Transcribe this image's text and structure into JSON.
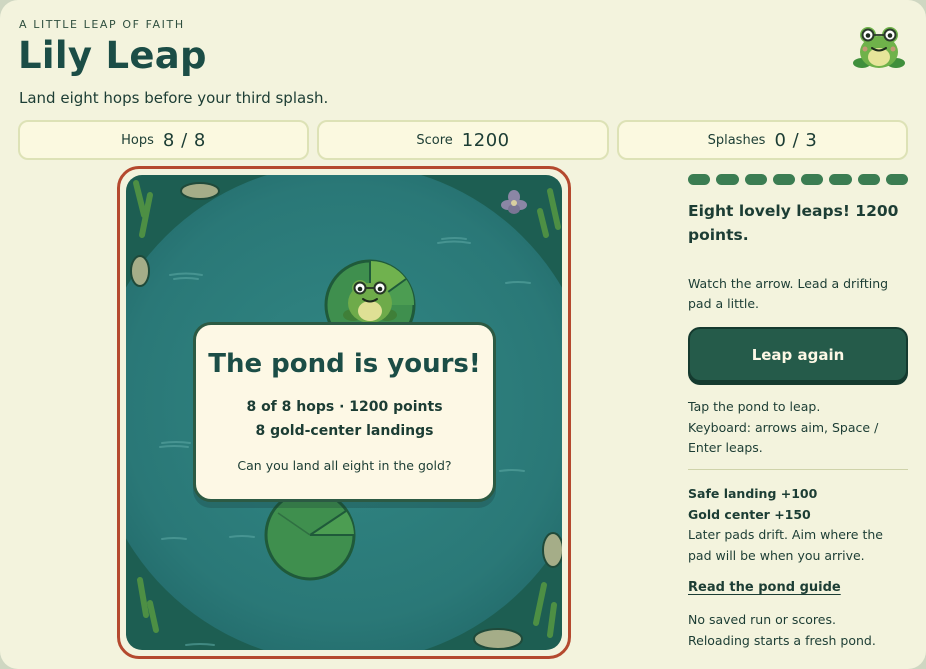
{
  "header": {
    "eyebrow": "A LITTLE LEAP OF FAITH",
    "title": "Lily Leap",
    "subtitle": "Land eight hops before your third splash."
  },
  "stats": {
    "hops_label": "Hops",
    "hops_value": "8 / 8",
    "score_label": "Score",
    "score_value": "1200",
    "splashes_label": "Splashes",
    "splashes_value": "0 / 3"
  },
  "progress": {
    "completed": 8,
    "total": 8
  },
  "modal": {
    "title": "The pond is yours!",
    "line1": "8 of 8 hops · 1200 points",
    "line2": "8 gold-center landings",
    "prompt": "Can you land all eight in the gold?"
  },
  "sidebar": {
    "result": "Eight lovely leaps! 1200 points.",
    "hint": "Watch the arrow. Lead a drifting pad a little.",
    "button_label": "Leap again",
    "controls_1": "Tap the pond to leap.",
    "controls_2": "Keyboard: arrows aim, Space / Enter leaps.",
    "rule_safe": "Safe landing +100",
    "rule_gold": "Gold center +150",
    "rule_drift": "Later pads drift. Aim where the pad will be when you arrive.",
    "guide_link": "Read the pond guide",
    "note_1": "No saved run or scores.",
    "note_2": "Reloading starts a fresh pond."
  },
  "icons": [
    "frog-mascot-icon",
    "frog-icon",
    "lotus-flower-icon"
  ],
  "colors": {
    "background": "#f3f3dd",
    "pond": "#2c7a7a",
    "accent_border": "#b4492e",
    "button": "#255b4a",
    "lily_pad": "#3f8f4e"
  }
}
